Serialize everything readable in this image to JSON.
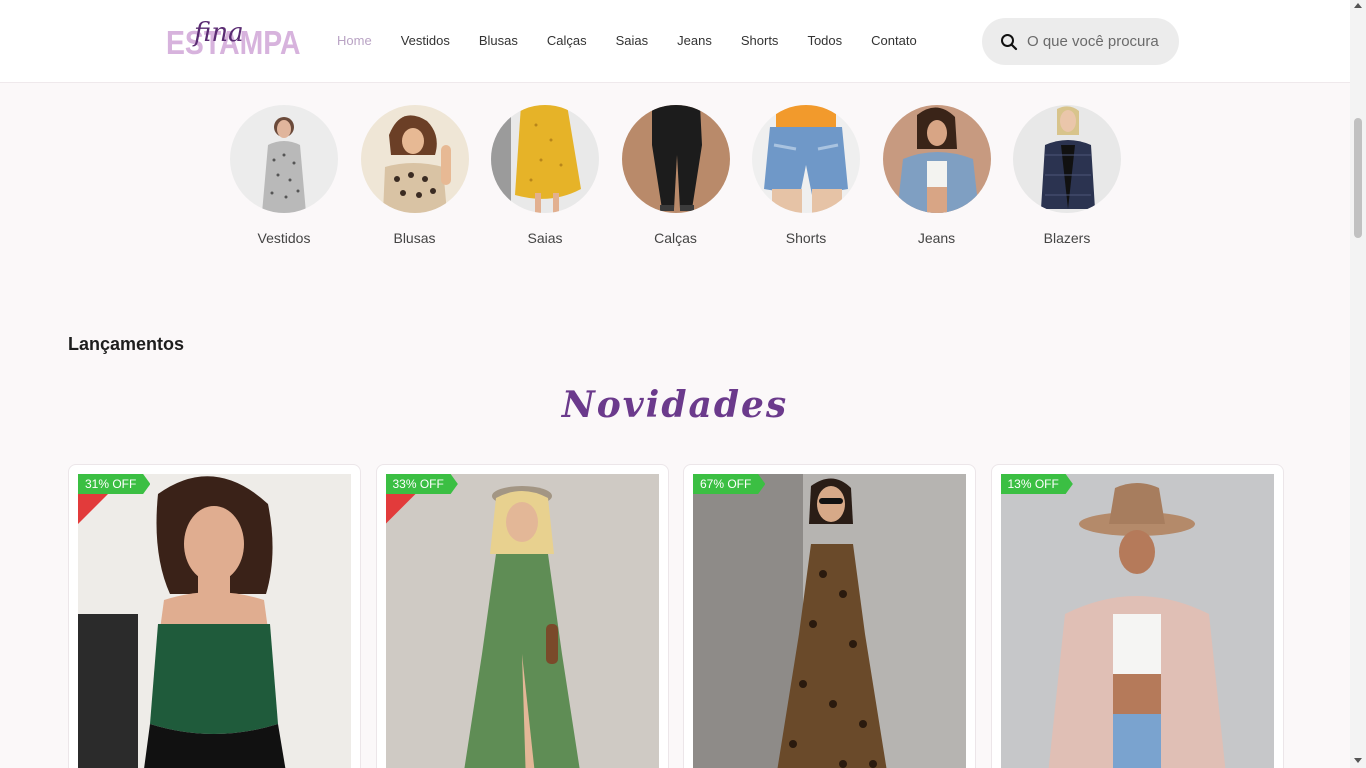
{
  "header": {
    "logo_main": "ESTAMPA",
    "logo_script": "fina",
    "nav": [
      {
        "label": "Home",
        "active": true
      },
      {
        "label": "Vestidos"
      },
      {
        "label": "Blusas"
      },
      {
        "label": "Calças"
      },
      {
        "label": "Saias"
      },
      {
        "label": "Jeans"
      },
      {
        "label": "Shorts"
      },
      {
        "label": "Todos"
      },
      {
        "label": "Contato"
      }
    ],
    "search": {
      "placeholder": "O que você procura",
      "icon": "search-icon"
    }
  },
  "categories": [
    {
      "label": "Vestidos"
    },
    {
      "label": "Blusas"
    },
    {
      "label": "Saias"
    },
    {
      "label": "Calças"
    },
    {
      "label": "Shorts"
    },
    {
      "label": "Jeans"
    },
    {
      "label": "Blazers"
    }
  ],
  "section": {
    "title": "Lançamentos",
    "script_title": "Novidades"
  },
  "products": [
    {
      "badge": "31% OFF",
      "ribbon": true
    },
    {
      "badge": "33% OFF",
      "ribbon": true
    },
    {
      "badge": "67% OFF",
      "ribbon": false
    },
    {
      "badge": "13% OFF",
      "ribbon": false
    }
  ],
  "colors": {
    "accent": "#6b3a8c",
    "logo": "#d7b3dd",
    "nav_active": "#b9a3c4",
    "badge": "#3bbf43",
    "ribbon": "#e23b3b",
    "page_bg": "#fbf8f9"
  }
}
